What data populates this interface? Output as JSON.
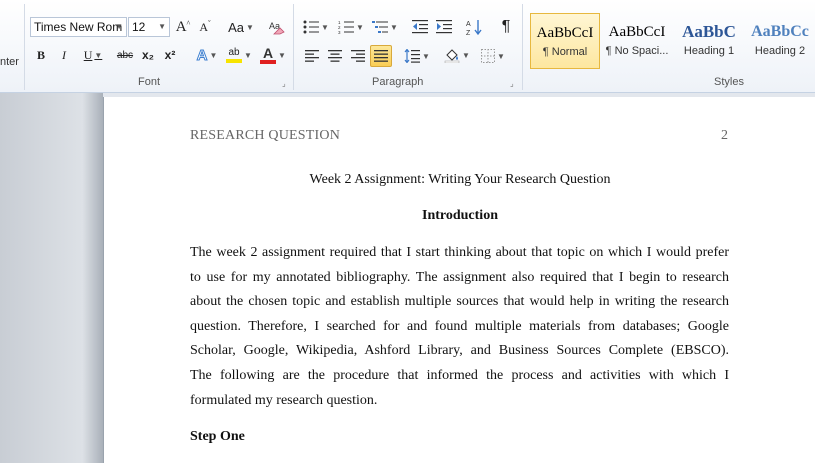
{
  "ribbon": {
    "clipboard_partial_label": "nter",
    "font": {
      "group_label": "Font",
      "font_name": "Times New Rom",
      "font_size": "12",
      "grow_glyph": "A",
      "shrink_glyph": "A",
      "change_case": "Aa",
      "bold": "B",
      "italic": "I",
      "underline": "U",
      "strikethrough": "abc",
      "subscript": "x₂",
      "superscript": "x²",
      "text_effects": "A",
      "highlight": "ab",
      "font_color": "A",
      "font_color_value": "#e02020",
      "highlight_color_value": "#f7e400"
    },
    "paragraph": {
      "group_label": "Paragraph",
      "pilcrow": "¶"
    },
    "styles": {
      "group_label": "Styles",
      "items": [
        {
          "sample": "AaBbCcI",
          "name": "¶ Normal"
        },
        {
          "sample": "AaBbCcI",
          "name": "¶ No Spaci..."
        },
        {
          "sample": "AaBbC",
          "name": "Heading 1"
        },
        {
          "sample": "AaBbCc",
          "name": "Heading 2"
        }
      ]
    }
  },
  "document": {
    "running_head": "RESEARCH QUESTION",
    "page_number": "2",
    "title": "Week 2 Assignment: Writing Your Research Question",
    "heading_intro": "Introduction",
    "paragraph_lines": [
      "The week 2 assignment required that I start thinking about that topic on which I would prefer",
      "to use for my annotated bibliography. The assignment also required that I begin to research",
      "about the chosen topic and establish multiple sources that would help in writing the research",
      "question. Therefore, I searched for and found multiple materials from databases; Google",
      "Scholar, Google, Wikipedia, Ashford Library, and Business Sources Complete (EBSCO).",
      "The following are the procedure that informed the process and activities with which I",
      "formulated my research question."
    ],
    "heading_step": "Step One"
  }
}
